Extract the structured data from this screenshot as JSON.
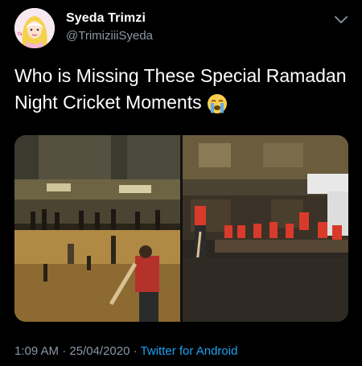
{
  "user": {
    "display_name": "Syeda Trimzi",
    "handle": "@TrimiziiiSyeda",
    "avatar_icon": "cartoon-girl-hijab-avatar"
  },
  "tweet": {
    "text": "Who is Missing These Special Ramadan Night Cricket Moments",
    "emoji_icon": "loudly-crying-face-emoji"
  },
  "media": {
    "images": [
      {
        "icon": "street-cricket-photo-1"
      },
      {
        "icon": "street-cricket-photo-2"
      }
    ]
  },
  "meta": {
    "time": "1:09 AM",
    "separator1": " · ",
    "date": "25/04/2020",
    "separator2": " · ",
    "source": "Twitter for Android"
  },
  "colors": {
    "background": "#000000",
    "secondary_text": "#8b98a5",
    "link": "#1da1f2"
  }
}
